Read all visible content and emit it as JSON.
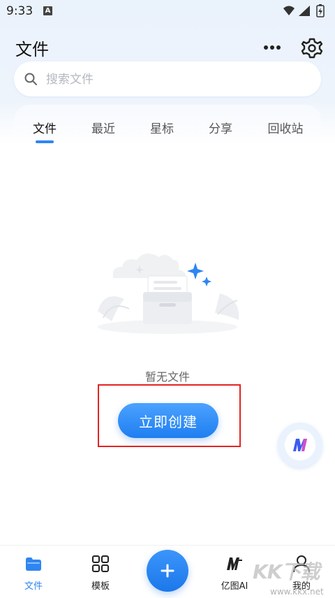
{
  "status": {
    "time": "9:33",
    "notification_badge": "A"
  },
  "header": {
    "title": "文件",
    "more_icon": "more-dots-icon",
    "settings_icon": "gear-icon"
  },
  "search": {
    "placeholder": "搜索文件",
    "icon": "search-icon"
  },
  "tabs": [
    {
      "label": "文件",
      "active": true
    },
    {
      "label": "最近",
      "active": false
    },
    {
      "label": "星标",
      "active": false
    },
    {
      "label": "分享",
      "active": false
    },
    {
      "label": "回收站",
      "active": false
    }
  ],
  "empty_state": {
    "message": "暂无文件",
    "create_button": "立即创建"
  },
  "bottom_nav": [
    {
      "label": "文件",
      "icon": "folder-icon",
      "active": true
    },
    {
      "label": "模板",
      "icon": "grid-icon",
      "active": false
    },
    {
      "label": "",
      "icon": "plus-icon",
      "active": false
    },
    {
      "label": "亿图AI",
      "icon": "ai-logo-icon",
      "active": false
    },
    {
      "label": "我的",
      "icon": "user-icon",
      "active": false
    }
  ],
  "watermark": {
    "logo": "KK下载",
    "url": "www.kkx.net"
  },
  "colors": {
    "accent": "#2f86f0",
    "highlight": "#e32424"
  }
}
